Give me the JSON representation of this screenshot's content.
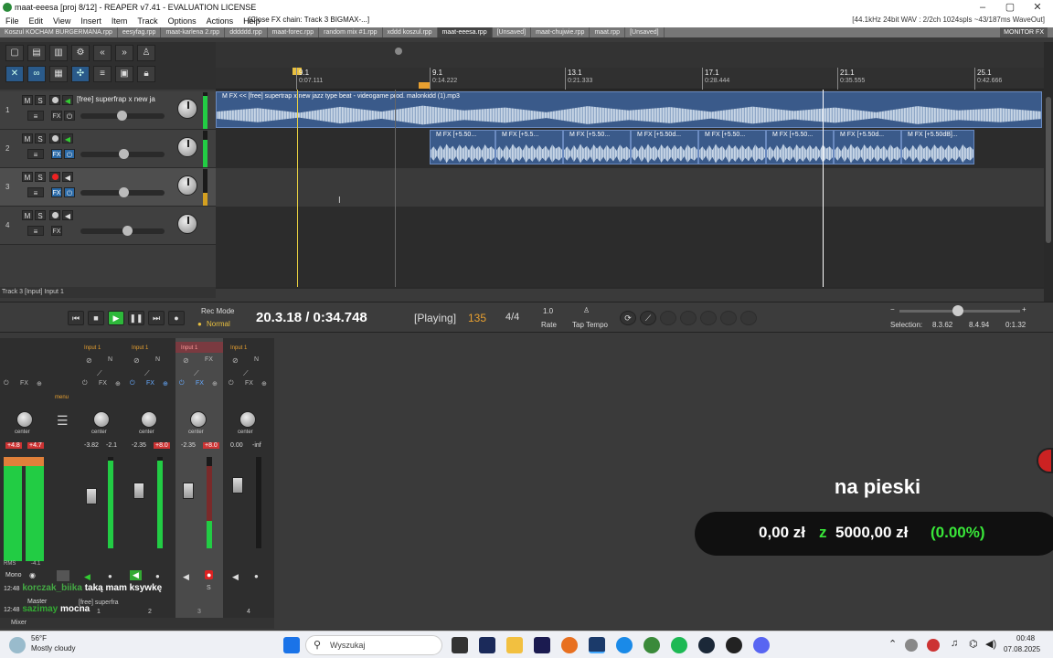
{
  "window": {
    "title": "maat-eeesa [proj 8/12] - REAPER v7.41 - EVALUATION LICENSE",
    "audio_info": "[44.1kHz 24bit WAV : 2/2ch 1024spls ~43/187ms WaveOut]"
  },
  "menu": {
    "items": [
      "File",
      "Edit",
      "View",
      "Insert",
      "Item",
      "Track",
      "Options",
      "Actions",
      "Help"
    ],
    "fx_chain": "[Close FX chain: Track 3 BIGMAX-...]"
  },
  "project_tabs": [
    {
      "label": "Koszul KOCHAM BURGERMANA.rpp",
      "active": false
    },
    {
      "label": "eesyfag.rpp",
      "active": false
    },
    {
      "label": "maat-karlena 2.rpp",
      "active": false
    },
    {
      "label": "dddddd.rpp",
      "active": false
    },
    {
      "label": "maat-forec.rpp",
      "active": false
    },
    {
      "label": "random mix #1.rpp",
      "active": false
    },
    {
      "label": "xddd koszul.rpp",
      "active": false
    },
    {
      "label": "maat-eeesa.rpp",
      "active": true
    },
    {
      "label": "[Unsaved]",
      "active": false
    },
    {
      "label": "maat-chujwie.rpp",
      "active": false
    },
    {
      "label": "maat.rpp",
      "active": false
    },
    {
      "label": "[Unsaved]",
      "active": false
    }
  ],
  "monitor_fx": "MONITOR FX",
  "ruler": {
    "markers": [
      {
        "bar": "9.1",
        "time": "0:07.111"
      },
      {
        "bar": "9.1",
        "time": "0:14.222"
      },
      {
        "bar": "13.1",
        "time": "0:21.333"
      },
      {
        "bar": "17.1",
        "time": "0:28.444"
      },
      {
        "bar": "21.1",
        "time": "0:35.555"
      },
      {
        "bar": "25.1",
        "time": "0:42.666"
      }
    ]
  },
  "tracks": [
    {
      "num": "1",
      "name": "[free] superfrap x new ja",
      "armed": false
    },
    {
      "num": "2",
      "name": "",
      "armed": false
    },
    {
      "num": "3",
      "name": "",
      "armed": true
    },
    {
      "num": "4",
      "name": "",
      "armed": false
    }
  ],
  "tcp_status": "Track 3 [Input] Input 1",
  "items": {
    "main_clip": "M FX << [free] supertrap x new jazz type beat - videogame prod. malonkidd (1).mp3",
    "small_clips": [
      "M FX [+5.50...",
      "M FX [+5.5...",
      "M FX [+5.50...",
      "M FX [+5.50d...",
      "M FX [+5.50...",
      "M FX [+5.50...",
      "M FX [+5.50d...",
      "M FX [+5.50dB]..."
    ]
  },
  "transport": {
    "rec_mode_label": "Rec Mode",
    "rec_mode_value": "Normal",
    "position": "20.3.18 / 0:34.748",
    "state": "[Playing]",
    "bpm": "135",
    "time_sig": "4/4",
    "rate_value": "1.0",
    "rate_label": "Rate",
    "tap_tempo": "Tap Tempo",
    "selection_label": "Selection:",
    "selection_start": "8.3.62",
    "selection_end": "8.4.94",
    "selection_len": "0:1.32"
  },
  "mixer": {
    "input_labels": [
      "Input 1",
      "Input 1",
      "Input 1",
      "Input 1"
    ],
    "master": {
      "pan": "center",
      "vol": "+4.8",
      "peak": "+4.7",
      "rms_label": "RMS",
      "rms": "-4.1",
      "mono": "Mono",
      "name": "Master"
    },
    "strips": [
      {
        "pan": "center",
        "vol": "0.00",
        "peak": "-3.82",
        "peak2": "-2.1",
        "num": "1",
        "name": "[free] superfra"
      },
      {
        "pan": "center",
        "vol": "-2.35",
        "peak": "+8.0",
        "num": "2",
        "name": ""
      },
      {
        "pan": "center",
        "vol": "-2.35",
        "peak": "+8.0",
        "num": "3",
        "name": ""
      },
      {
        "pan": "center",
        "vol": "0.00",
        "peak": "-inf",
        "num": "4",
        "name": ""
      }
    ],
    "menu_label": "menu",
    "dock_label": "Mixer"
  },
  "chat": [
    {
      "time": "12:48",
      "user": "korczak_biika",
      "msg": "taką mam ksywkę"
    },
    {
      "time": "12:48",
      "user": "sazimay",
      "msg": "mocna"
    }
  ],
  "donation": {
    "title": "na pieski",
    "current": "0,00 zł",
    "sep": "z",
    "goal": "5000,00 zł",
    "pct": "(0.00%)"
  },
  "taskbar": {
    "weather_temp": "56°F",
    "weather_desc": "Mostly cloudy",
    "search_placeholder": "Wyszukaj",
    "time": "00:48",
    "date": "07.08.2025"
  }
}
